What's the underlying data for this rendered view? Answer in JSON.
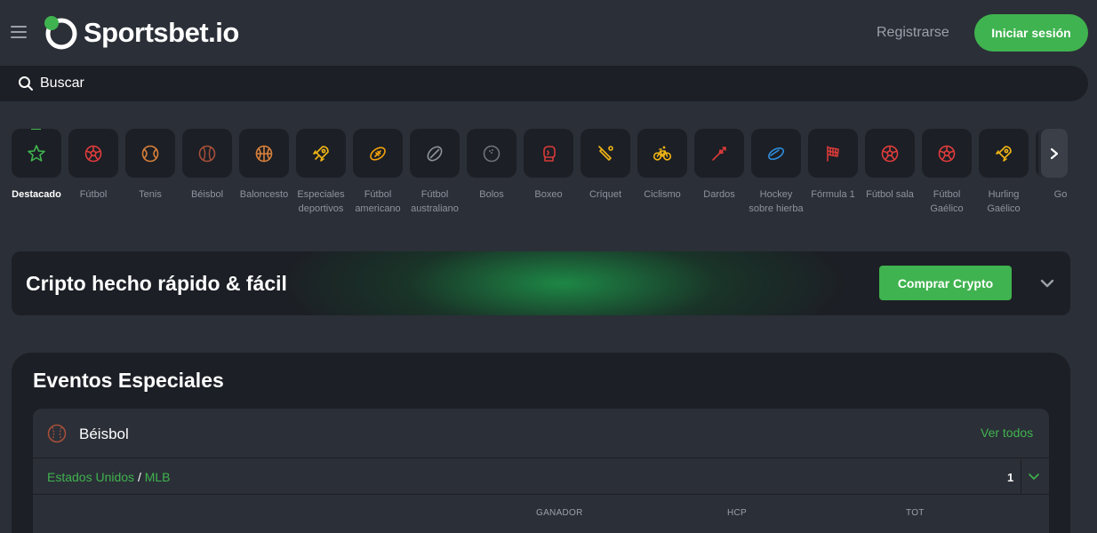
{
  "header": {
    "logo_text": "Sportsbet.io",
    "register_label": "Registrarse",
    "login_label": "Iniciar sesión"
  },
  "search": {
    "placeholder": "Buscar"
  },
  "sports": [
    {
      "label": "Destacado",
      "icon": "star-icon",
      "active": true,
      "color": "#3fb34f"
    },
    {
      "label": "Fútbol",
      "icon": "soccer-ball-icon",
      "color": "#e03c3c"
    },
    {
      "label": "Tenis",
      "icon": "tennis-ball-icon",
      "color": "#d9803a"
    },
    {
      "label": "Béisbol",
      "icon": "baseball-icon",
      "color": "#a8503a"
    },
    {
      "label": "Baloncesto",
      "icon": "basketball-icon",
      "color": "#d9803a"
    },
    {
      "label": "Especiales deportivos",
      "icon": "rocket-icon",
      "color": "#f2b515"
    },
    {
      "label": "Fútbol americano",
      "icon": "american-football-icon",
      "color": "#f2a20c"
    },
    {
      "label": "Fútbol australiano",
      "icon": "aussie-football-icon",
      "color": "#8d949e"
    },
    {
      "label": "Bolos",
      "icon": "bowling-ball-icon",
      "color": "#6e737c"
    },
    {
      "label": "Boxeo",
      "icon": "boxing-glove-icon",
      "color": "#d83a3a"
    },
    {
      "label": "Críquet",
      "icon": "cricket-bat-icon",
      "color": "#f2b515"
    },
    {
      "label": "Ciclismo",
      "icon": "bicycle-icon",
      "color": "#f2b515"
    },
    {
      "label": "Dardos",
      "icon": "dart-icon",
      "color": "#d83a3a"
    },
    {
      "label": "Hockey sobre hierba",
      "icon": "hockey-puck-icon",
      "color": "#2f8fe0"
    },
    {
      "label": "Fórmula 1",
      "icon": "checkered-flag-icon",
      "color": "#d83a3a"
    },
    {
      "label": "Fútbol sala",
      "icon": "futsal-ball-icon",
      "color": "#e03c3c"
    },
    {
      "label": "Fútbol Gaélico",
      "icon": "gaelic-football-icon",
      "color": "#e03c3c"
    },
    {
      "label": "Hurling Gaélico",
      "icon": "hurling-icon",
      "color": "#f2b515"
    },
    {
      "label": "Go",
      "icon": "golf-icon",
      "color": "#d9803a"
    }
  ],
  "crypto_banner": {
    "title": "Cripto hecho rápido & fácil",
    "button_label": "Comprar Crypto"
  },
  "events": {
    "title": "Eventos Especiales",
    "card": {
      "sport": "Béisbol",
      "see_all": "Ver todos",
      "country": "Estados Unidos",
      "separator": "/",
      "league": "MLB",
      "count": "1",
      "columns": [
        "GANADOR",
        "HCP",
        "TOT"
      ]
    }
  },
  "colors": {
    "accent": "#3fb34f",
    "background": "#2b2f37",
    "panel": "#1c1f25"
  }
}
